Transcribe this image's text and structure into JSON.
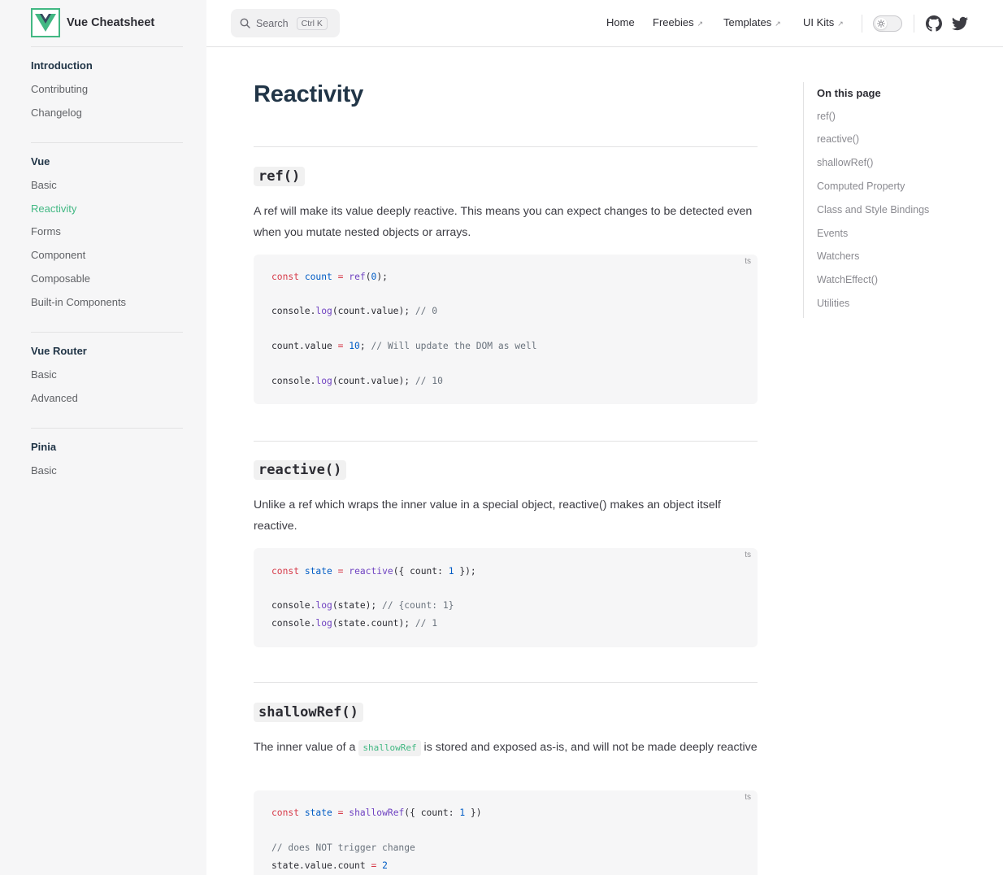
{
  "brand": {
    "name": "Vue Cheatsheet",
    "logo_letter": "V",
    "accent": "#42b883"
  },
  "sidebar": {
    "groups": [
      {
        "title": "Introduction",
        "items": [
          "Contributing",
          "Changelog"
        ]
      },
      {
        "title": "Vue",
        "items": [
          "Basic",
          "Reactivity",
          "Forms",
          "Component",
          "Composable",
          "Built-in Components"
        ],
        "active": "Reactivity"
      },
      {
        "title": "Vue Router",
        "items": [
          "Basic",
          "Advanced"
        ]
      },
      {
        "title": "Pinia",
        "items": [
          "Basic"
        ]
      }
    ]
  },
  "topbar": {
    "search_label": "Search",
    "search_shortcut": "Ctrl K",
    "nav": [
      "Home",
      "Freebies",
      "Templates",
      "UI Kits"
    ],
    "external_arrow": "↗",
    "icons": [
      "sun-icon",
      "github-icon",
      "twitter-icon"
    ]
  },
  "page": {
    "title": "Reactivity",
    "sections": [
      {
        "heading": "ref()",
        "text": "A ref will make its value deeply reactive. This means you can expect changes to be detected even when you mutate nested objects or arrays.",
        "lang": "ts"
      },
      {
        "heading": "reactive()",
        "text": "Unlike a ref which wraps the inner value in a special object, reactive() makes an object itself reactive.",
        "lang": "ts"
      },
      {
        "heading": "shallowRef()",
        "text_before": "The inner value of a",
        "inline_code": "shallowRef",
        "text_after": "is stored and exposed as-is, and will not be made deeply reactive",
        "lang": "ts"
      }
    ]
  },
  "toc": {
    "title": "On this page",
    "items": [
      "ref()",
      "reactive()",
      "shallowRef()",
      "Computed Property",
      "Class and Style Bindings",
      "Events",
      "Watchers",
      "WatchEffect()",
      "Utilities"
    ]
  }
}
